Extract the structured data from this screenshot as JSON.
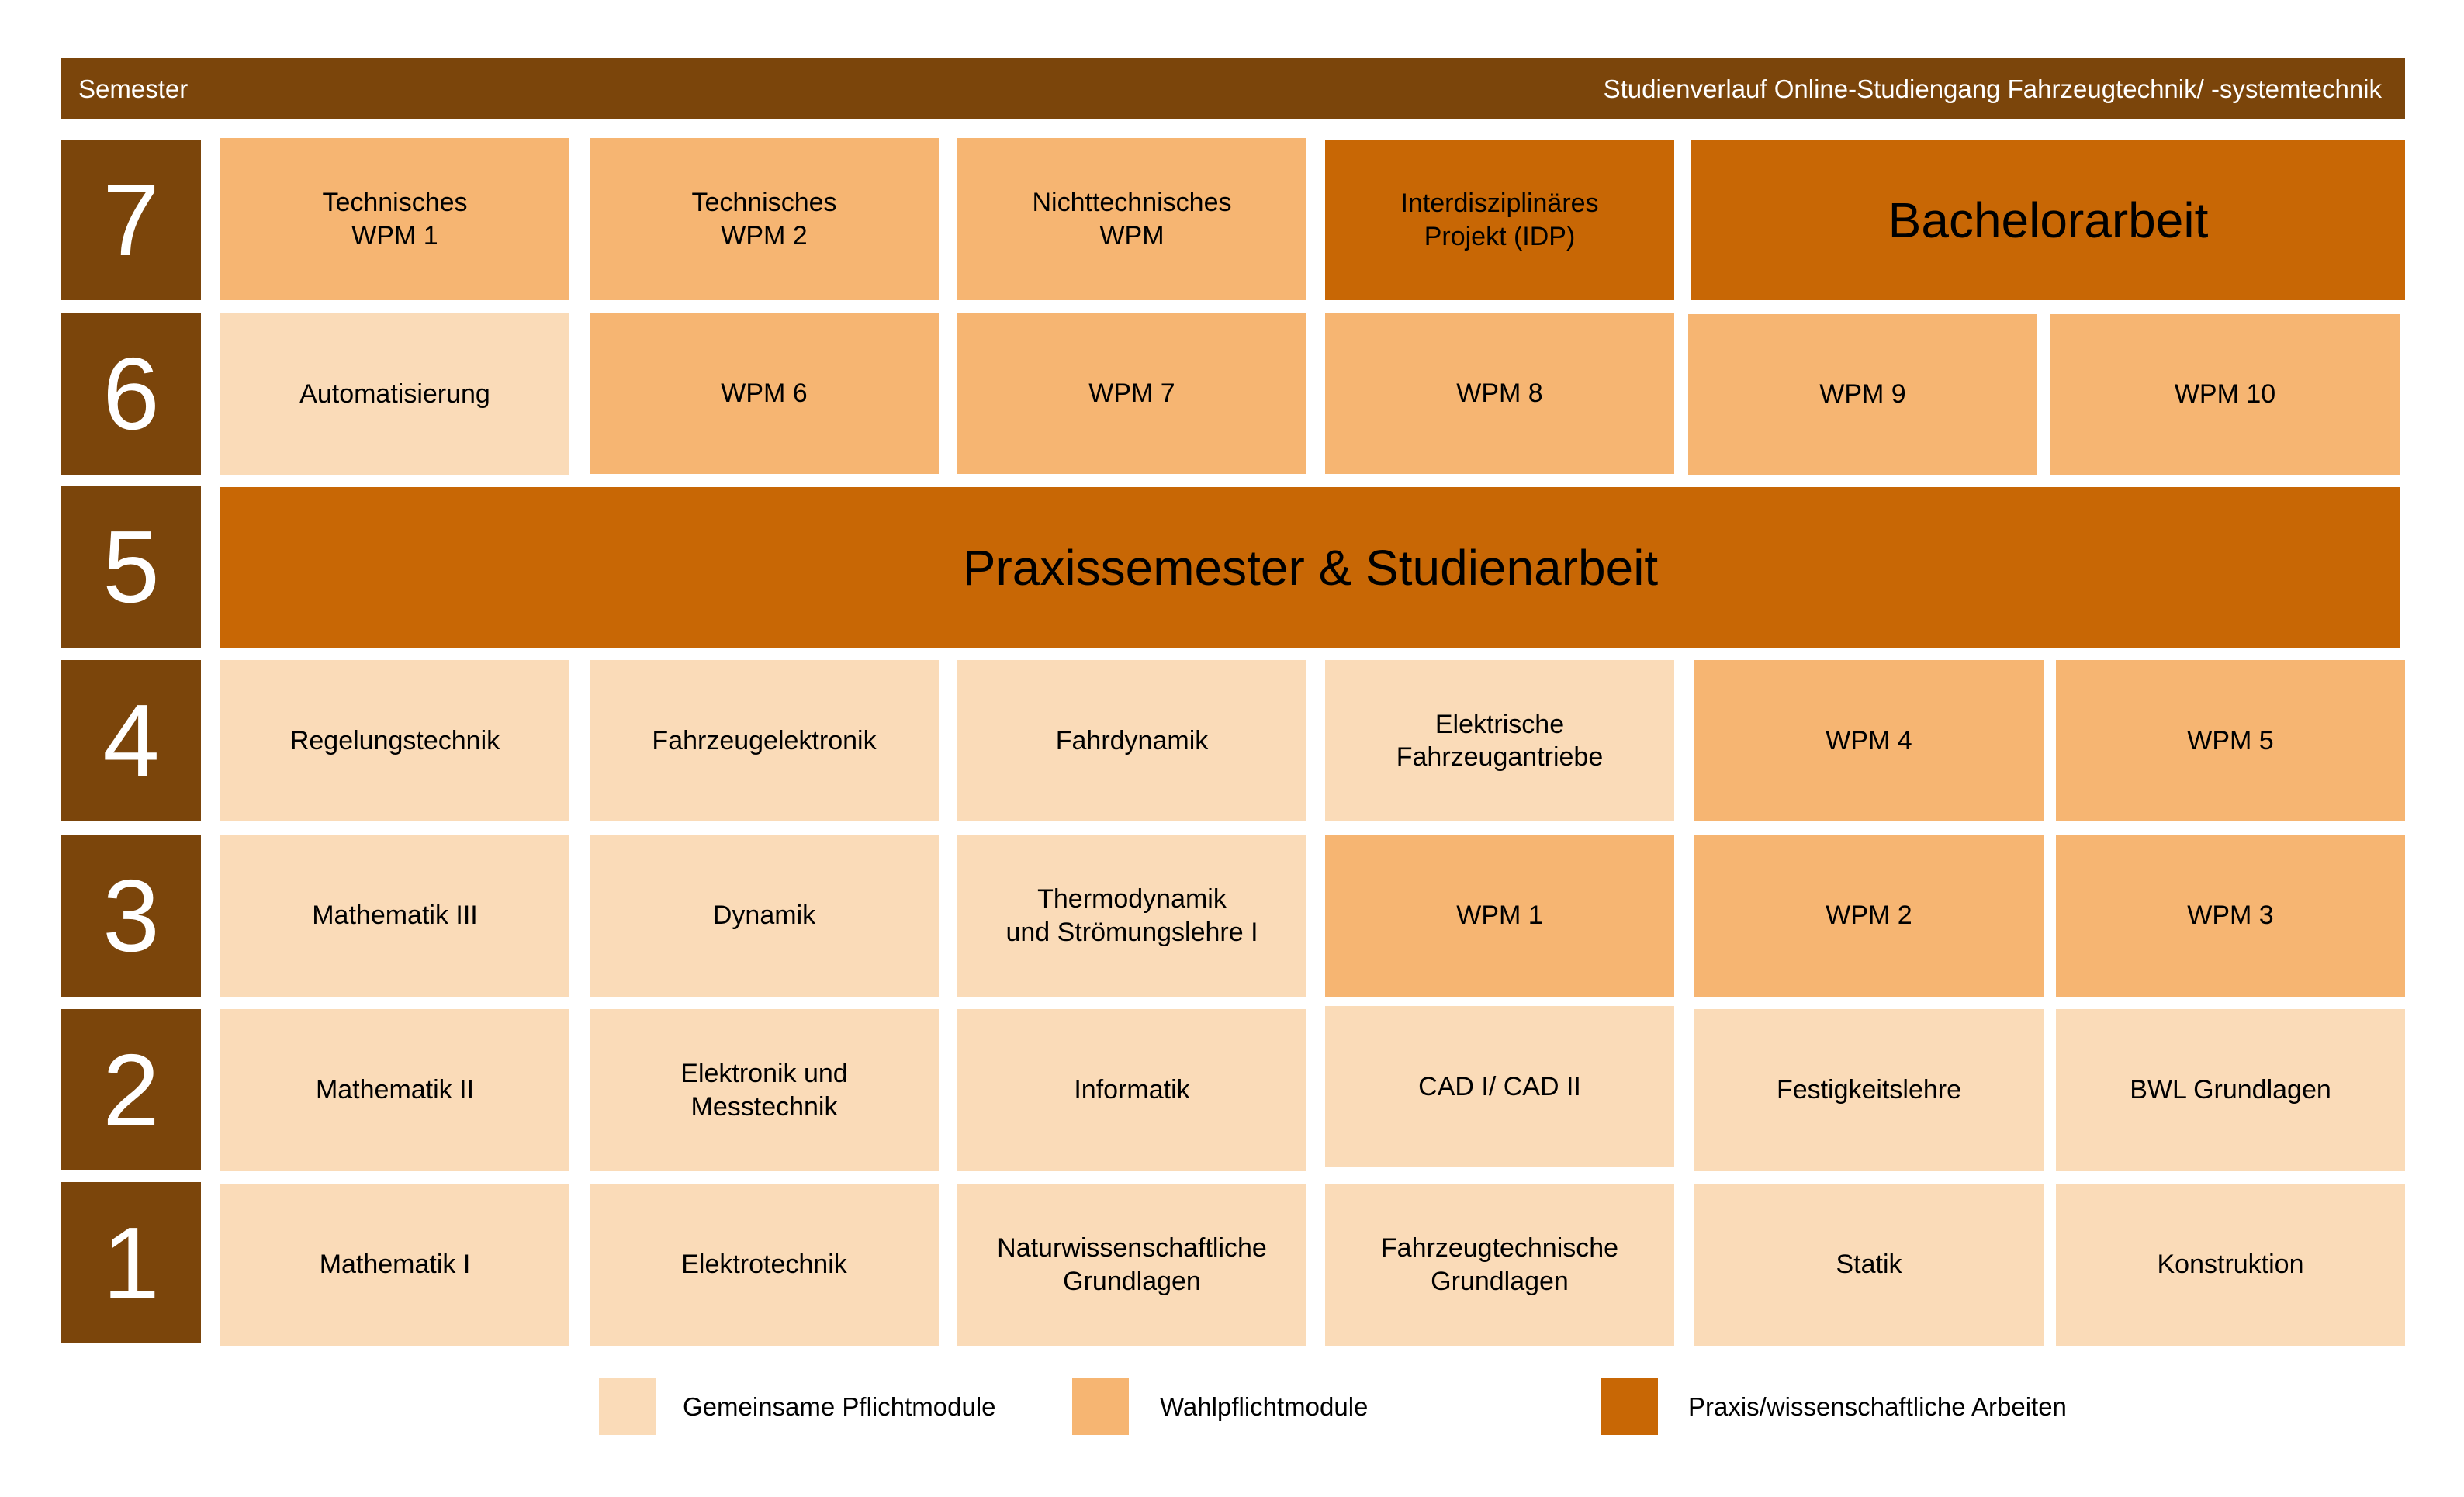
{
  "header": {
    "left_label": "Semester",
    "title": "Studienverlauf Online-Studiengang Fahrzeugtechnik/ -systemtechnik"
  },
  "colors": {
    "semester_bar": "#7B450B",
    "pflicht": "#FADBB8",
    "wahlpflicht": "#F6B572",
    "praxis": "#C86705"
  },
  "semesters": [
    {
      "number": "7",
      "modules": [
        {
          "label": "Technisches\nWPM 1",
          "type": "wahlpflicht"
        },
        {
          "label": "Technisches\nWPM 2",
          "type": "wahlpflicht"
        },
        {
          "label": "Nichttechnisches\nWPM",
          "type": "wahlpflicht"
        },
        {
          "label": "Interdisziplinäres\nProjekt (IDP)",
          "type": "praxis"
        },
        {
          "label": "Bachelorarbeit",
          "type": "praxis"
        }
      ]
    },
    {
      "number": "6",
      "modules": [
        {
          "label": "Automatisierung",
          "type": "pflicht"
        },
        {
          "label": "WPM 6",
          "type": "wahlpflicht"
        },
        {
          "label": "WPM 7",
          "type": "wahlpflicht"
        },
        {
          "label": "WPM 8",
          "type": "wahlpflicht"
        },
        {
          "label": "WPM 9",
          "type": "wahlpflicht"
        },
        {
          "label": "WPM 10",
          "type": "wahlpflicht"
        }
      ]
    },
    {
      "number": "5",
      "modules": [
        {
          "label": "Praxissemester & Studienarbeit",
          "type": "praxis"
        }
      ]
    },
    {
      "number": "4",
      "modules": [
        {
          "label": "Regelungstechnik",
          "type": "pflicht"
        },
        {
          "label": "Fahrzeugelektronik",
          "type": "pflicht"
        },
        {
          "label": "Fahrdynamik",
          "type": "pflicht"
        },
        {
          "label": "Elektrische\nFahrzeugantriebe",
          "type": "pflicht"
        },
        {
          "label": "WPM 4",
          "type": "wahlpflicht"
        },
        {
          "label": "WPM 5",
          "type": "wahlpflicht"
        }
      ]
    },
    {
      "number": "3",
      "modules": [
        {
          "label": "Mathematik III",
          "type": "pflicht"
        },
        {
          "label": "Dynamik",
          "type": "pflicht"
        },
        {
          "label": "Thermodynamik\nund Strömungslehre I",
          "type": "pflicht"
        },
        {
          "label": "WPM 1",
          "type": "wahlpflicht"
        },
        {
          "label": "WPM 2",
          "type": "wahlpflicht"
        },
        {
          "label": "WPM 3",
          "type": "wahlpflicht"
        }
      ]
    },
    {
      "number": "2",
      "modules": [
        {
          "label": "Mathematik II",
          "type": "pflicht"
        },
        {
          "label": "Elektronik und\nMesstechnik",
          "type": "pflicht"
        },
        {
          "label": "Informatik",
          "type": "pflicht"
        },
        {
          "label": "CAD I/ CAD II",
          "type": "pflicht"
        },
        {
          "label": "Festigkeitslehre",
          "type": "pflicht"
        },
        {
          "label": "BWL Grundlagen",
          "type": "pflicht"
        }
      ]
    },
    {
      "number": "1",
      "modules": [
        {
          "label": "Mathematik I",
          "type": "pflicht"
        },
        {
          "label": "Elektrotechnik",
          "type": "pflicht"
        },
        {
          "label": "Naturwissenschaftliche\nGrundlagen",
          "type": "pflicht"
        },
        {
          "label": "Fahrzeugtechnische\nGrundlagen",
          "type": "pflicht"
        },
        {
          "label": "Statik",
          "type": "pflicht"
        },
        {
          "label": "Konstruktion",
          "type": "pflicht"
        }
      ]
    }
  ],
  "legend": [
    {
      "label": "Gemeinsame Pflichtmodule",
      "type": "pflicht"
    },
    {
      "label": "Wahlpflichtmodule",
      "type": "wahlpflicht"
    },
    {
      "label": "Praxis/wissenschaftliche Arbeiten",
      "type": "praxis"
    }
  ]
}
